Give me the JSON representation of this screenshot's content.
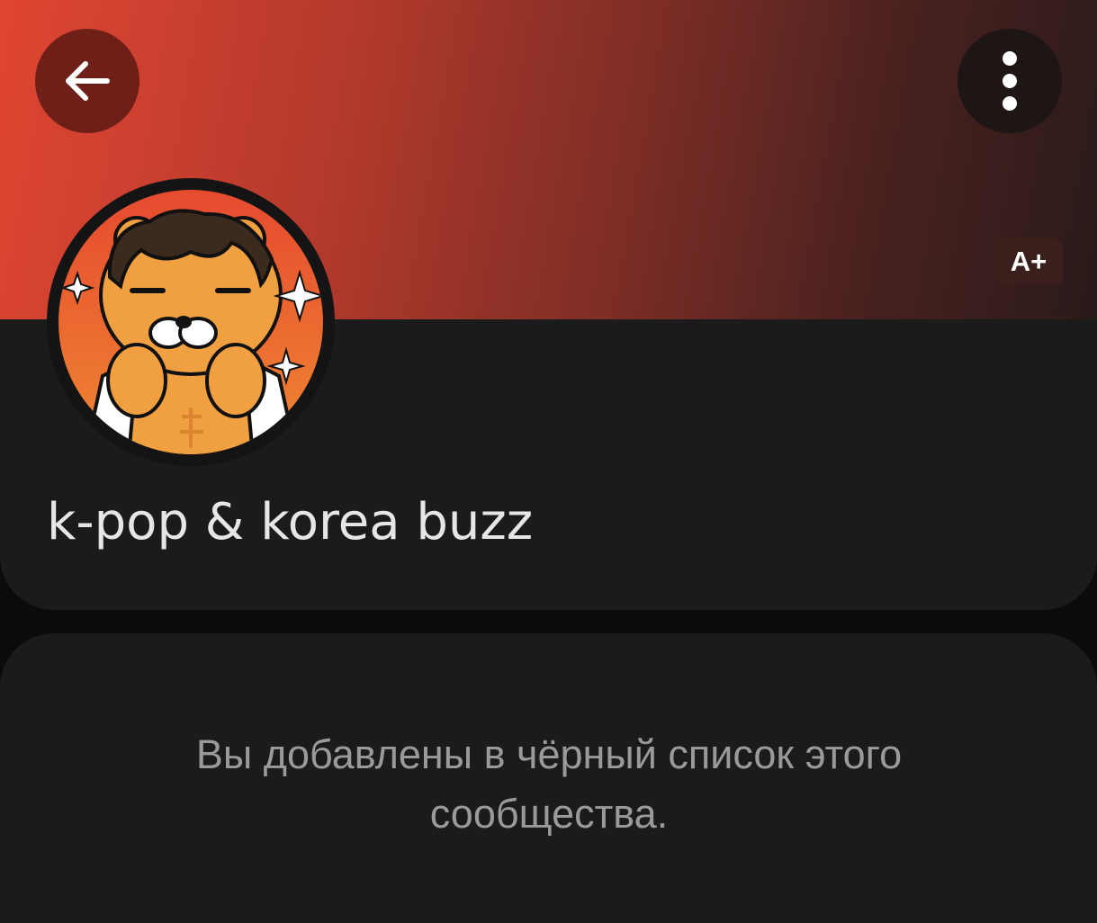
{
  "community": {
    "name": "k-pop & korea buzz"
  },
  "header": {
    "text_size_label": "A+",
    "back_icon": "arrow-left-icon",
    "menu_icon": "more-vertical-icon"
  },
  "notice": {
    "line1": "Вы добавлены в чёрный список этого",
    "line2": "сообщества."
  },
  "colors": {
    "cover_start": "#e04532",
    "cover_end": "#2a1a1a",
    "card_background": "#1b1b1b",
    "page_background": "#0b0b0b"
  }
}
